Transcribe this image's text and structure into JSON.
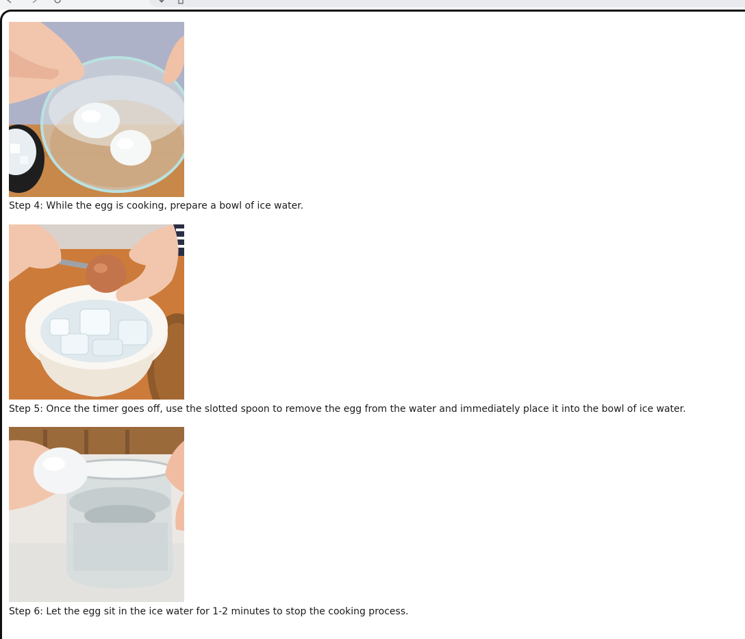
{
  "browser": {
    "toolbar_icons": [
      "back-arrow-icon",
      "forward-arrow-icon",
      "reload-icon",
      "download-icon",
      "page-icon"
    ]
  },
  "steps": [
    {
      "caption": "Step 4: While the egg is cooking, prepare a bowl of ice water.",
      "image": "Hands holding a glass bowl of water with two peeled eggs, a black bowl of ice beside it on a wooden table"
    },
    {
      "caption": "Step 5: Once the timer goes off, use the slotted spoon to remove the egg from the water and immediately place it into the bowl of ice water.",
      "image": "Hands lowering a brown egg with a spoon into a white ramekin filled with ice cubes and water"
    },
    {
      "caption": "Step 6: Let the egg sit in the ice water for 1-2 minutes to stop the cooking process.",
      "image": "Hands holding a peeled white egg next to a clear glass jar of water on a white board"
    }
  ],
  "colors": {
    "wood": "#c8884a",
    "ice_water": "#dfe9ee",
    "bowl_white": "#f6f1ea",
    "egg_brown": "#c4744a",
    "skin": "#f2c6ad"
  }
}
